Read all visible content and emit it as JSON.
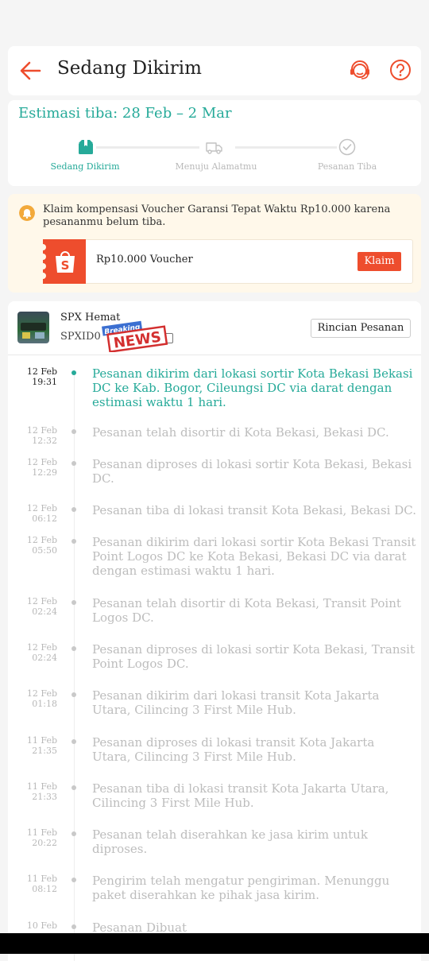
{
  "header": {
    "title": "Sedang Dikirim"
  },
  "status": {
    "eta": "Estimasi tiba: 28 Feb – 2 Mar",
    "steps": [
      {
        "label": "Sedang Dikirim"
      },
      {
        "label": "Menuju Alamatmu"
      },
      {
        "label": "Pesanan Tiba"
      }
    ],
    "colors": {
      "accent": "#26aa99",
      "inactive": "#b9b9b9"
    }
  },
  "voucher": {
    "message": "Klaim kompensasi Voucher Garansi Tepat Waktu Rp10.000 karena pesananmu belum tiba.",
    "ticket_text": "Rp10.000 Voucher",
    "claim_label": "Klaim",
    "icon": "shopee-bag-icon",
    "brand_color": "#ee4d2d"
  },
  "shipment": {
    "courier": "SPX Hemat",
    "tracking_prefix": "SPXID0",
    "details_label": "Rincian Pesanan",
    "sticker": {
      "top": "Breaking",
      "bottom": "NEWS"
    }
  },
  "events": [
    {
      "date": "12 Feb",
      "time": "19:31",
      "text": "Pesanan dikirim dari lokasi sortir Kota Bekasi  Bekasi DC ke Kab. Bogor, Cileungsi DC via darat dengan estimasi waktu 1 hari.",
      "active": true
    },
    {
      "date": "12 Feb",
      "time": "12:32",
      "text": "Pesanan telah disortir di Kota Bekasi, Bekasi DC."
    },
    {
      "date": "12 Feb",
      "time": "12:29",
      "text": "Pesanan diproses di lokasi sortir Kota Bekasi, Bekasi DC."
    },
    {
      "date": "12 Feb",
      "time": "06:12",
      "text": "Pesanan tiba di lokasi transit Kota Bekasi, Bekasi DC."
    },
    {
      "date": "12 Feb",
      "time": "05:50",
      "text": "Pesanan dikirim dari lokasi sortir Kota Bekasi Transit Point Logos DC ke Kota Bekasi, Bekasi DC via darat dengan estimasi waktu 1 hari."
    },
    {
      "date": "12 Feb",
      "time": "02:24",
      "text": "Pesanan telah disortir di Kota Bekasi, Transit Point Logos DC."
    },
    {
      "date": "12 Feb",
      "time": "02:24",
      "text": "Pesanan diproses di lokasi sortir Kota Bekasi, Transit Point Logos DC."
    },
    {
      "date": "12 Feb",
      "time": "01:18",
      "text": "Pesanan dikirim dari lokasi transit Kota Jakarta Utara, Cilincing 3 First Mile Hub."
    },
    {
      "date": "11 Feb",
      "time": "21:35",
      "text": "Pesanan diproses di lokasi transit Kota Jakarta Utara, Cilincing 3 First Mile Hub."
    },
    {
      "date": "11 Feb",
      "time": "21:33",
      "text": "Pesanan tiba di lokasi transit Kota Jakarta Utara, Cilincing 3 First Mile Hub."
    },
    {
      "date": "11 Feb",
      "time": "20:22",
      "text": "Pesanan telah diserahkan ke jasa kirim untuk diproses."
    },
    {
      "date": "11 Feb",
      "time": "08:12",
      "text": "Pengirim telah mengatur pengiriman. Menunggu paket diserahkan ke pihak jasa kirim."
    },
    {
      "date": "10 Feb",
      "time": "",
      "text": "Pesanan Dibuat"
    }
  ]
}
